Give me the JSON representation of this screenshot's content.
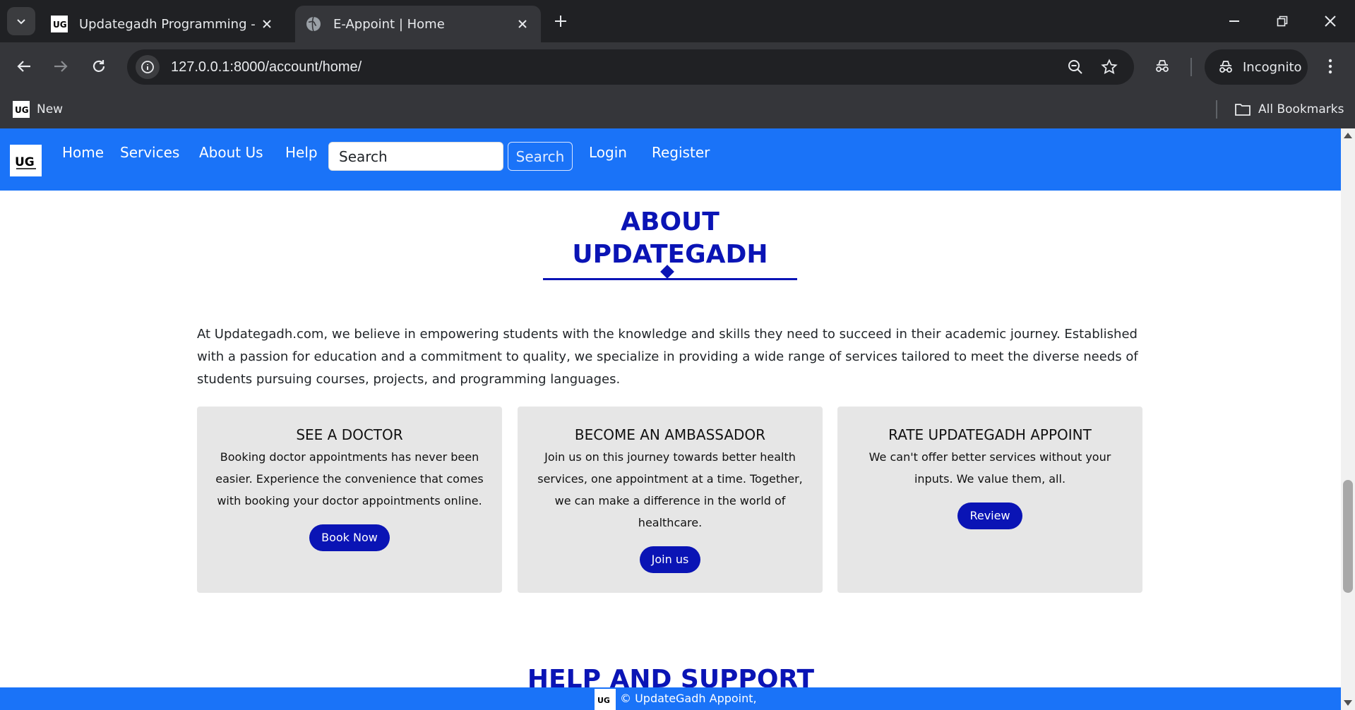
{
  "browser": {
    "tabs": [
      {
        "title": "Updategadh Programming - Up",
        "active": false
      },
      {
        "title": "E-Appoint | Home",
        "active": true
      }
    ],
    "url": "127.0.0.1:8000/account/home/",
    "incognito_label": "Incognito",
    "bookmarks": {
      "new_label": "New",
      "all_bookmarks_label": "All Bookmarks"
    }
  },
  "site": {
    "logo_text": "UG",
    "nav": {
      "home": "Home",
      "services": "Services",
      "about": "About Us",
      "help": "Help",
      "search_placeholder": "Search",
      "search_button": "Search",
      "login": "Login",
      "register": "Register"
    },
    "about": {
      "title_line1": "ABOUT",
      "title_line2": "UPDATEGADH",
      "paragraph": "At Updategadh.com, we believe in empowering students with the knowledge and skills they need to succeed in their academic journey. Established with a passion for education and a commitment to quality, we specialize in providing a wide range of services tailored to meet the diverse needs of students pursuing courses, projects, and programming languages."
    },
    "cards": [
      {
        "title": "SEE A DOCTOR",
        "text": "Booking doctor appointments has never been easier. Experience the convenience that comes with booking your doctor appointments online.",
        "button": "Book Now"
      },
      {
        "title": "BECOME AN AMBASSADOR",
        "text": "Join us on this journey towards better health services, one appointment at a time. Together, we can make a difference in the world of healthcare.",
        "button": "Join us"
      },
      {
        "title": "RATE UPDATEGADH APPOINT",
        "text": "We can't offer better services without your inputs. We value them, all.",
        "button": "Review"
      }
    ],
    "help_title": "HELP AND SUPPORT",
    "footer": {
      "text": "© UpdateGadh Appoint,"
    }
  },
  "colors": {
    "nav_blue": "#1a73f8",
    "brand_navy": "#0a14b5",
    "card_gray": "#e6e6e6"
  }
}
